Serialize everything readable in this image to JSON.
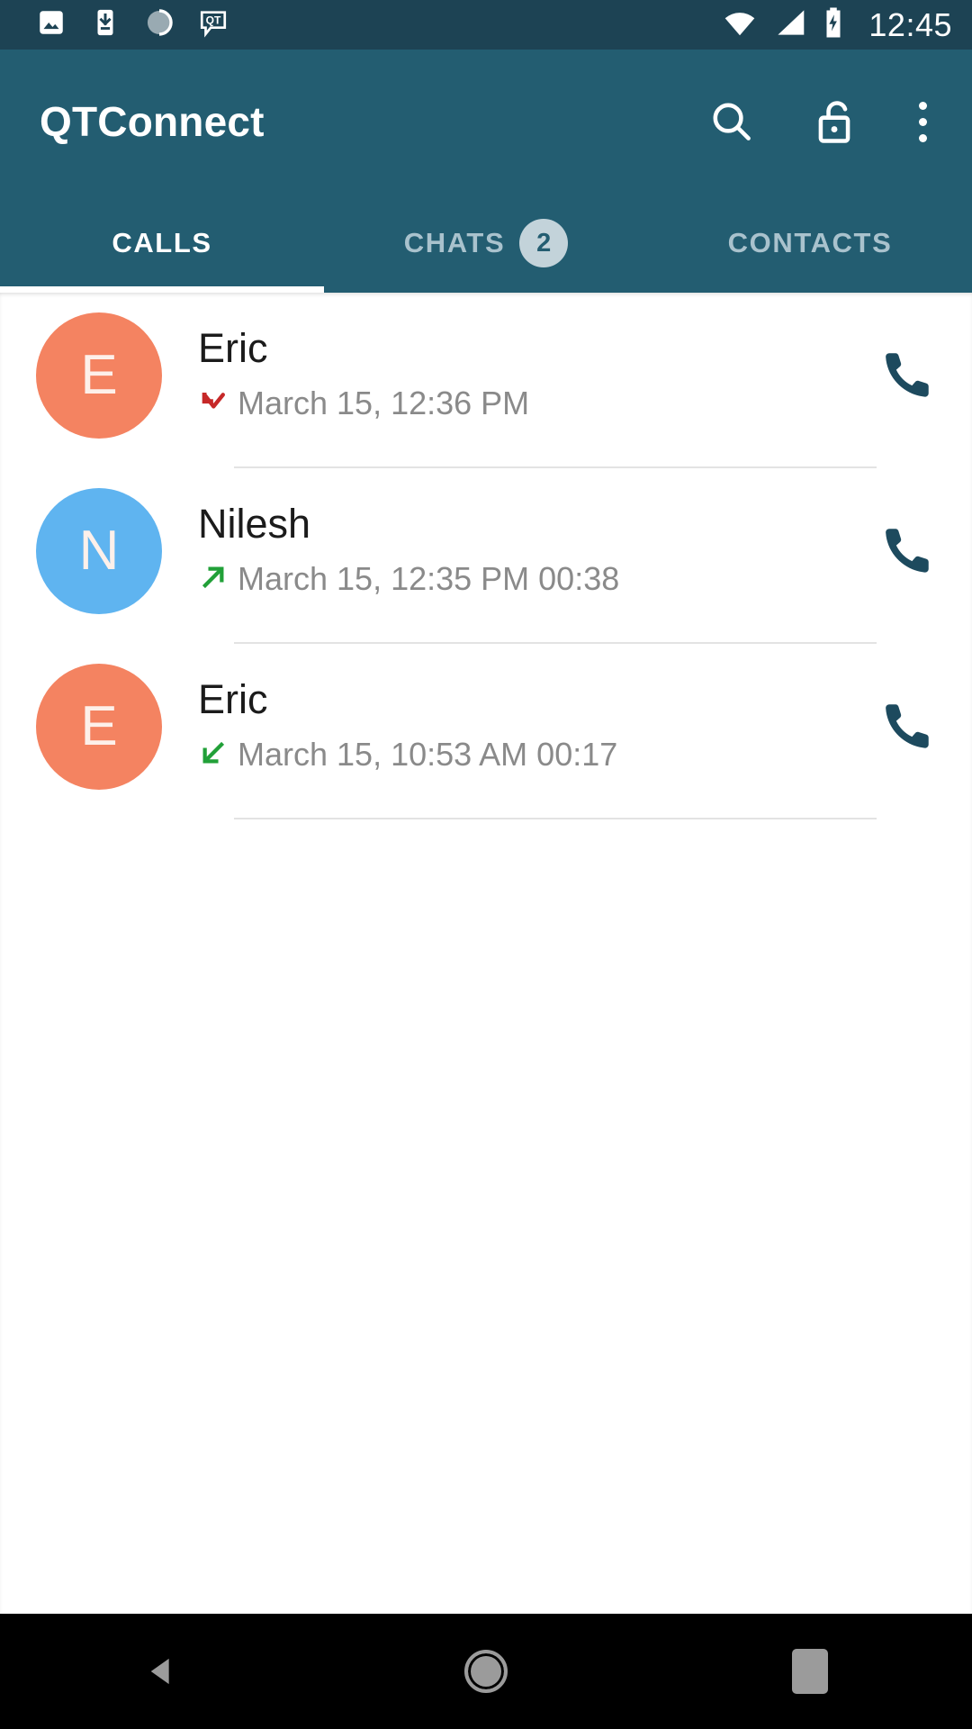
{
  "status_bar": {
    "background": "#1d4354",
    "clock": "12:45",
    "left_icons": [
      {
        "name": "image-notification-icon",
        "label": "image"
      },
      {
        "name": "download-notification-icon",
        "label": "download"
      },
      {
        "name": "sync-progress-icon",
        "label": "sync"
      },
      {
        "name": "qt-message-notification-icon",
        "label": "QT"
      }
    ],
    "right_icons": [
      {
        "name": "wifi-icon",
        "label": "wifi"
      },
      {
        "name": "cellular-signal-icon",
        "label": "signal"
      },
      {
        "name": "battery-charging-icon",
        "label": "battery charging"
      }
    ]
  },
  "app_bar": {
    "title": "QTConnect",
    "background": "#235d71",
    "actions": [
      {
        "name": "search-button",
        "label": "Search"
      },
      {
        "name": "lock-button",
        "label": "Unlock"
      },
      {
        "name": "overflow-menu-button",
        "label": "More options"
      }
    ]
  },
  "tabs": {
    "active_index": 0,
    "items": [
      {
        "label": "CALLS",
        "badge": null
      },
      {
        "label": "CHATS",
        "badge": "2"
      },
      {
        "label": "CONTACTS",
        "badge": null
      }
    ]
  },
  "calls": {
    "rows": [
      {
        "name": "Eric",
        "avatar_letter": "E",
        "avatar_color": "#f48361",
        "call_type": "missed",
        "call_type_color": "#c62828",
        "meta": "March 15, 12:36 PM",
        "action": "call-button"
      },
      {
        "name": "Nilesh",
        "avatar_letter": "N",
        "avatar_color": "#5fb4f0",
        "call_type": "outgoing",
        "call_type_color": "#21a038",
        "meta": "March 15, 12:35 PM 00:38",
        "action": "call-button"
      },
      {
        "name": "Eric",
        "avatar_letter": "E",
        "avatar_color": "#f48361",
        "call_type": "incoming",
        "call_type_color": "#21a038",
        "meta": "March 15, 10:53 AM 00:17",
        "action": "call-button"
      }
    ]
  },
  "nav_bar": {
    "background": "#000000",
    "buttons": [
      {
        "name": "nav-back-button",
        "label": "Back"
      },
      {
        "name": "nav-home-button",
        "label": "Home"
      },
      {
        "name": "nav-recents-button",
        "label": "Recents"
      }
    ]
  }
}
